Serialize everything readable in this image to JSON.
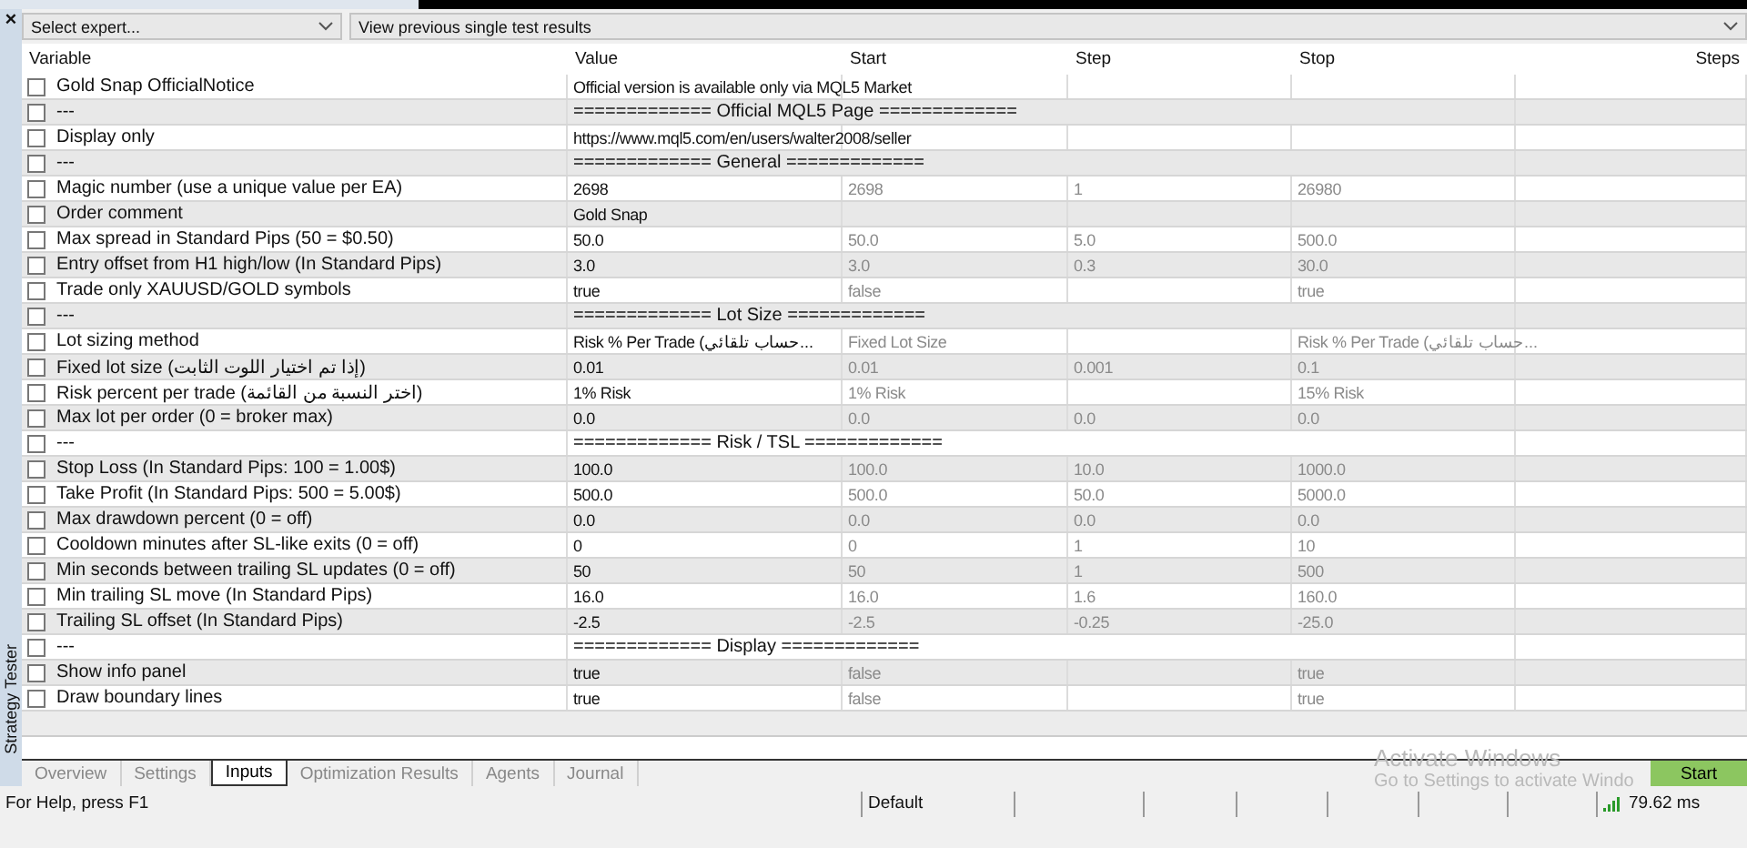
{
  "side_panel": {
    "close": "×",
    "title": "Strategy Tester"
  },
  "toolbar": {
    "expert_select": "Select expert...",
    "results_select": "View previous single test results"
  },
  "table": {
    "columns": [
      "Variable",
      "Value",
      "Start",
      "Step",
      "Stop",
      "Steps"
    ],
    "rows": [
      {
        "kind": "param",
        "checked": false,
        "variable": "Gold Snap OfficialNotice",
        "value": "Official version is available only via MQL5 Market"
      },
      {
        "kind": "separator",
        "checked": false,
        "variable": "---",
        "value": "============= Official MQL5 Page ============="
      },
      {
        "kind": "param",
        "checked": false,
        "variable": "Display only",
        "value": "https://www.mql5.com/en/users/walter2008/seller"
      },
      {
        "kind": "separator",
        "checked": false,
        "variable": "---",
        "value": "============= General ============="
      },
      {
        "kind": "param",
        "checked": false,
        "variable": "Magic number (use a unique value per EA)",
        "value": "2698",
        "start": "2698",
        "step": "1",
        "stop": "26980"
      },
      {
        "kind": "param",
        "checked": false,
        "variable": "Order comment",
        "value": "Gold Snap"
      },
      {
        "kind": "param",
        "checked": false,
        "variable": "Max spread in Standard Pips (50 = $0.50)",
        "value": "50.0",
        "start": "50.0",
        "step": "5.0",
        "stop": "500.0"
      },
      {
        "kind": "param",
        "checked": false,
        "variable": "Entry offset from H1 high/low (In Standard Pips)",
        "value": "3.0",
        "start": "3.0",
        "step": "0.3",
        "stop": "30.0"
      },
      {
        "kind": "param",
        "checked": false,
        "variable": "Trade only XAUUSD/GOLD symbols",
        "value": "true",
        "start": "false",
        "stop": "true"
      },
      {
        "kind": "separator",
        "checked": false,
        "variable": "---",
        "value": "============= Lot Size ============="
      },
      {
        "kind": "param",
        "checked": false,
        "variable": "Lot sizing method",
        "value": "Risk % Per Trade (حساب تلقائي...",
        "start": "Fixed Lot Size",
        "stop": "Risk % Per Trade (حساب تلقائي..."
      },
      {
        "kind": "param",
        "checked": false,
        "variable": "Fixed lot size (إذا تم اختيار اللوت الثابت)",
        "value": "0.01",
        "start": "0.01",
        "step": "0.001",
        "stop": "0.1"
      },
      {
        "kind": "param",
        "checked": false,
        "variable": "Risk percent per trade (اختر النسبة من القائمة)",
        "value": "1% Risk",
        "start": "1% Risk",
        "stop": "15% Risk"
      },
      {
        "kind": "param",
        "checked": false,
        "variable": "Max lot per order (0 = broker max)",
        "value": "0.0",
        "start": "0.0",
        "step": "0.0",
        "stop": "0.0"
      },
      {
        "kind": "separator",
        "checked": false,
        "variable": "---",
        "value": "============= Risk / TSL ============="
      },
      {
        "kind": "param",
        "checked": false,
        "variable": "Stop Loss (In Standard Pips: 100 = 1.00$)",
        "value": "100.0",
        "start": "100.0",
        "step": "10.0",
        "stop": "1000.0"
      },
      {
        "kind": "param",
        "checked": false,
        "variable": "Take Profit (In Standard Pips: 500 = 5.00$)",
        "value": "500.0",
        "start": "500.0",
        "step": "50.0",
        "stop": "5000.0"
      },
      {
        "kind": "param",
        "checked": false,
        "variable": "Max drawdown percent (0 = off)",
        "value": "0.0",
        "start": "0.0",
        "step": "0.0",
        "stop": "0.0"
      },
      {
        "kind": "param",
        "checked": false,
        "variable": "Cooldown minutes after SL-like exits (0 = off)",
        "value": "0",
        "start": "0",
        "step": "1",
        "stop": "10"
      },
      {
        "kind": "param",
        "checked": false,
        "variable": "Min seconds between trailing SL updates (0 = off)",
        "value": "50",
        "start": "50",
        "step": "1",
        "stop": "500"
      },
      {
        "kind": "param",
        "checked": false,
        "variable": "Min trailing SL move (In Standard Pips)",
        "value": "16.0",
        "start": "16.0",
        "step": "1.6",
        "stop": "160.0"
      },
      {
        "kind": "param",
        "checked": false,
        "variable": "Trailing SL offset (In Standard Pips)",
        "value": "-2.5",
        "start": "-2.5",
        "step": "-0.25",
        "stop": "-25.0"
      },
      {
        "kind": "separator",
        "checked": false,
        "variable": "---",
        "value": "============= Display ============="
      },
      {
        "kind": "param",
        "checked": false,
        "variable": "Show info panel",
        "value": "true",
        "start": "false",
        "stop": "true"
      },
      {
        "kind": "param",
        "checked": false,
        "variable": "Draw boundary lines",
        "value": "true",
        "start": "false",
        "stop": "true"
      }
    ]
  },
  "activation_notice": {
    "title": "Activate Windows",
    "text": "Go to Settings to activate Windo"
  },
  "tabs": [
    {
      "label": "Overview",
      "selected": false
    },
    {
      "label": "Settings",
      "selected": false
    },
    {
      "label": "Inputs",
      "selected": true
    },
    {
      "label": "Optimization Results",
      "selected": false
    },
    {
      "label": "Agents",
      "selected": false
    },
    {
      "label": "Journal",
      "selected": false
    }
  ],
  "start_button": "Start",
  "status_bar": {
    "help": "For Help, press F1",
    "profile": "Default",
    "ping": "79.62 ms"
  }
}
